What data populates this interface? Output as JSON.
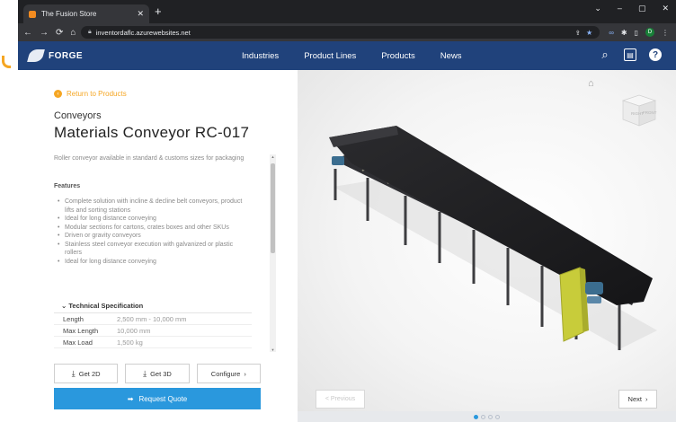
{
  "browser": {
    "tab_title": "The Fusion Store",
    "tab_close": "✕",
    "new_tab": "+",
    "url": "inventordaflc.azurewebsites.net",
    "window_controls": [
      "⌄",
      "–",
      "▢",
      "✕"
    ],
    "profile_initial": "D"
  },
  "site": {
    "logo_text": "FORGE",
    "nav": [
      "Industries",
      "Product Lines",
      "Products",
      "News"
    ]
  },
  "product": {
    "back_link": "Return to Products",
    "category": "Conveyors",
    "title": "Materials Conveyor RC-017",
    "description": "Roller conveyor available in standard & customs sizes for packaging",
    "features_heading": "Features",
    "features": [
      "Complete solution with incline & decline belt conveyors, product lifts and sorting stations",
      "Ideal for long distance conveying",
      "Modular sections for cartons, crates boxes and other SKUs",
      "Driven or gravity conveyors",
      "Stainless steel conveyor execution with galvanized or plastic rollers",
      "Ideal for long distance conveying"
    ],
    "tech_spec_heading": "Technical Specification",
    "specs": [
      {
        "label": "Length",
        "value": "2,500 mm - 10,000 mm"
      },
      {
        "label": "Max Length",
        "value": "10,000 mm"
      },
      {
        "label": "Max Load",
        "value": "1,500 kg"
      }
    ]
  },
  "actions": {
    "get2d": "Get 2D",
    "get3d": "Get 3D",
    "configure": "Configure",
    "request_quote": "Request Quote"
  },
  "viewer": {
    "viewcube_right": "RIGHT",
    "viewcube_front": "FRONT",
    "previous": "< Previous",
    "next": "Next",
    "pager": {
      "count": 4,
      "active": 0
    }
  },
  "colors": {
    "header_bg": "#20427b",
    "accent_orange": "#f5a623",
    "quote_blue": "#2a98dd",
    "conveyor_yellow": "#c8cc3a"
  }
}
